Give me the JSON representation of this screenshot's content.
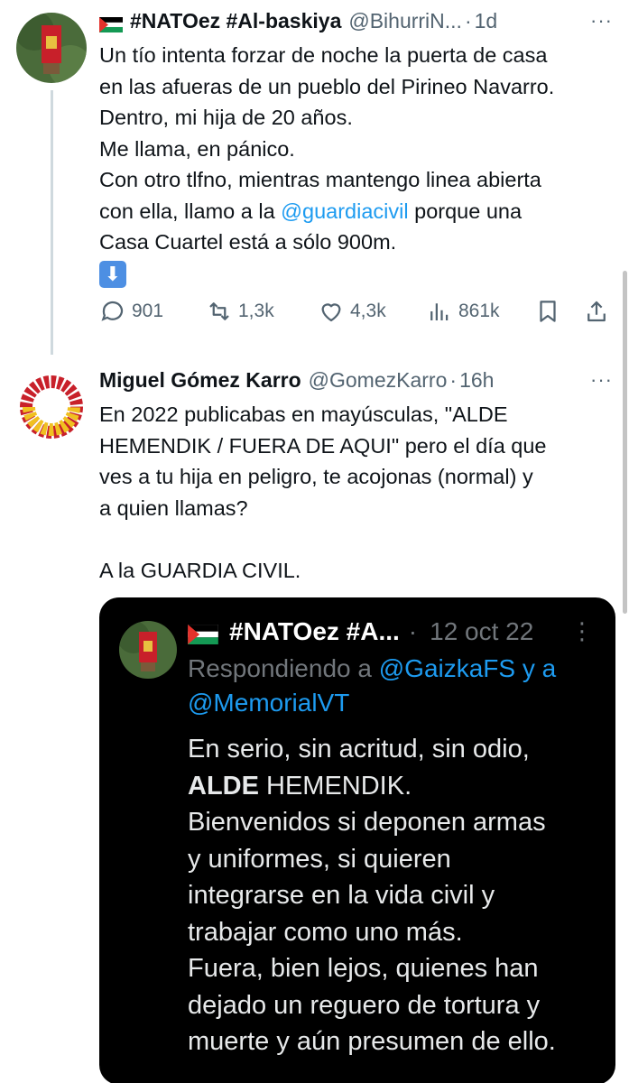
{
  "tweet1": {
    "author_name": "#NATOez #Al-baskiya",
    "handle": "@BihurriN...",
    "separator": "·",
    "time": "1d",
    "more": "···",
    "text_lines": [
      "Un tío intenta forzar de noche la puerta de casa",
      "en las afueras de un pueblo del Pirineo Navarro.",
      "Dentro, mi hija de 20 años.",
      "Me llama, en pánico.",
      "Con otro tlfno, mientras mantengo linea abierta"
    ],
    "line6_pre": "con ella, llamo a la ",
    "line6_mention": "@guardiacivil",
    "line6_post": " porque una",
    "line7": "Casa Cuartel está a sólo 900m.",
    "arrow_emoji": "⬇",
    "actions": {
      "reply_count": "901",
      "retweet_count": "1,3k",
      "like_count": "4,3k",
      "view_count": "861k"
    }
  },
  "tweet2": {
    "author_name": "Miguel Gómez Karro",
    "handle": "@GomezKarro",
    "separator": "·",
    "time": "16h",
    "more": "···",
    "text_lines": [
      "En 2022 publicabas en mayúsculas, \"ALDE",
      "HEMENDIK / FUERA DE AQUI\" pero el día que",
      "ves a tu hija en peligro, te acojonas (normal) y",
      "a quien llamas?"
    ],
    "text_final": "A la GUARDIA CIVIL."
  },
  "quote": {
    "author_name": "#NATOez #A...",
    "separator": "·",
    "date": "12 oct 22",
    "more": "⋮",
    "reply_prefix": "Respondiendo a ",
    "reply_mention1": "@GaizkaFS",
    "reply_and": " y a",
    "reply_mention2": "@MemorialVT",
    "line1": "En serio, sin acritud, sin odio,",
    "line2_bold": "ALDE",
    "line2_rest": " HEMENDIK.",
    "lines": [
      "Bienvenidos si deponen armas",
      "y uniformes, si quieren",
      "integrarse en la vida civil y",
      "trabajar como uno más.",
      "Fuera, bien lejos, quienes han",
      "dejado un reguero de tortura y",
      "muerte y aún presumen de ello."
    ]
  },
  "colors": {
    "link": "#1d9bf0",
    "secondary": "#536471",
    "quote_bg": "#000000"
  }
}
